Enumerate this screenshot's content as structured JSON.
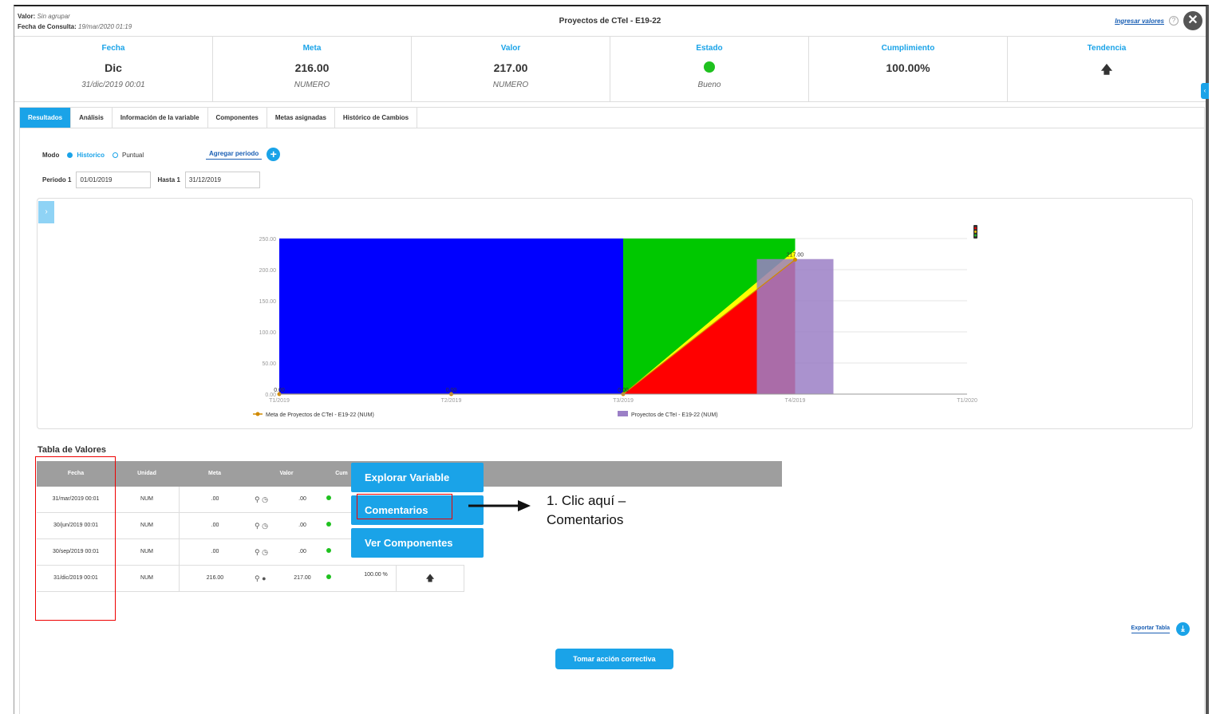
{
  "topbar": {
    "valor_label": "Valor:",
    "valor_value": "Sin agrupar",
    "fecha_label": "Fecha de Consulta:",
    "fecha_value": "19/mar/2020 01:19",
    "title": "Proyectos de CTeI - E19-22",
    "ingresar_label": "Ingresar valores",
    "help_icon": "?",
    "close_icon": "✕"
  },
  "summary": [
    {
      "head": "Fecha",
      "value": "Dic",
      "sub": "31/dic/2019 00:01"
    },
    {
      "head": "Meta",
      "value": "216.00",
      "sub": "NUMERO"
    },
    {
      "head": "Valor",
      "value": "217.00",
      "sub": "NUMERO"
    },
    {
      "head": "Estado",
      "value": "",
      "sub": "Bueno",
      "status_color": "#1fc11f"
    },
    {
      "head": "Cumplimiento",
      "value": "100.00%",
      "sub": ""
    },
    {
      "head": "Tendencia",
      "value": "🡅",
      "sub": ""
    }
  ],
  "tabs": [
    "Resultados",
    "Análisis",
    "Información de la variable",
    "Componentes",
    "Metas asignadas",
    "Histórico de Cambios"
  ],
  "modo": {
    "label": "Modo",
    "option1": "Historico",
    "option2": "Puntual",
    "add_period": "Agregar periodo",
    "plus": "+"
  },
  "period": {
    "label1": "Periodo 1",
    "value1": "01/01/2019",
    "label2": "Hasta 1",
    "value2": "31/12/2019"
  },
  "chart_data": {
    "type": "area",
    "x_ticks": [
      "T1/2019",
      "T2/2019",
      "T3/2019",
      "T4/2019",
      "T1/2020"
    ],
    "y_ticks": [
      "0.00",
      "50.00",
      "100.00",
      "150.00",
      "200.00",
      "250.00"
    ],
    "ylim": [
      0,
      250
    ],
    "bands": [
      {
        "color": "#0000ff",
        "from": "T1/2019",
        "to": "T3/2019",
        "y": 250
      },
      {
        "color": "#00c800",
        "from": "T3/2019",
        "to": "T4/2019",
        "y": 250
      }
    ],
    "series": [
      {
        "name": "Meta de Proyectos de CTeI - E19-22 (NUM)",
        "type": "line",
        "color": "#d08a00",
        "values": [
          0,
          0,
          0,
          216
        ]
      },
      {
        "name": "Proyectos de CTeI - E19-22 (NUM)",
        "type": "bar",
        "color": "#9b7fc6",
        "values": [
          0,
          0,
          0,
          217
        ]
      }
    ],
    "point_labels": [
      "0.00",
      "0.00",
      "0.00",
      "217.00"
    ]
  },
  "table": {
    "title": "Tabla de Valores",
    "headers": [
      "Fecha",
      "Unidad",
      "Meta",
      "Valor",
      "Cum"
    ],
    "rows": [
      {
        "fecha": "31/mar/2019 00:01",
        "unidad": "NUM",
        "meta": ".00",
        "valor": ".00",
        "cumplimiento": "",
        "tendencia": ""
      },
      {
        "fecha": "30/jun/2019 00:01",
        "unidad": "NUM",
        "meta": ".00",
        "valor": ".00",
        "cumplimiento": "",
        "tendencia": ""
      },
      {
        "fecha": "30/sep/2019 00:01",
        "unidad": "NUM",
        "meta": ".00",
        "valor": ".00",
        "cumplimiento": "",
        "tendencia": ""
      },
      {
        "fecha": "31/dic/2019 00:01",
        "unidad": "NUM",
        "meta": "216.00",
        "valor": "217.00",
        "cumplimiento": "100.00 %",
        "tendencia": "🡅"
      }
    ]
  },
  "context_menu": [
    "Explorar Variable",
    "Comentarios",
    "Ver Componentes"
  ],
  "annotation": {
    "line1": "1. Clic aquí –",
    "line2": "Comentarios"
  },
  "export_label": "Exportar Tabla",
  "action_button": "Tomar acción correctiva"
}
